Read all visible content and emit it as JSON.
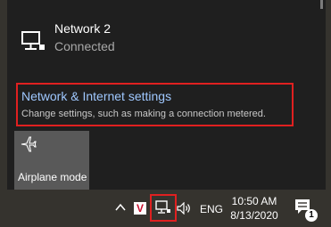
{
  "flyout": {
    "network": {
      "name": "Network 2",
      "status": "Connected",
      "icon": "ethernet-monitor-icon"
    },
    "settings_link": {
      "title": "Network & Internet settings",
      "description": "Change settings, such as making a connection metered."
    },
    "quick_actions": [
      {
        "label": "Airplane mode",
        "icon": "airplane-icon"
      }
    ]
  },
  "taskbar": {
    "tray_icons": [
      "show-hidden-icons-chevron",
      "app-tray-icon",
      "network-icon",
      "volume-icon"
    ],
    "app_tray_letter": "V",
    "language": "ENG",
    "time": "10:50 AM",
    "date": "8/13/2020",
    "notification_count": "1"
  },
  "colors": {
    "flyout_bg": "#1f1f1f",
    "link_text": "#9fc8ff",
    "highlight_box": "#e02020",
    "tile_bg": "#595959",
    "taskbar_bg": "#35332e"
  }
}
